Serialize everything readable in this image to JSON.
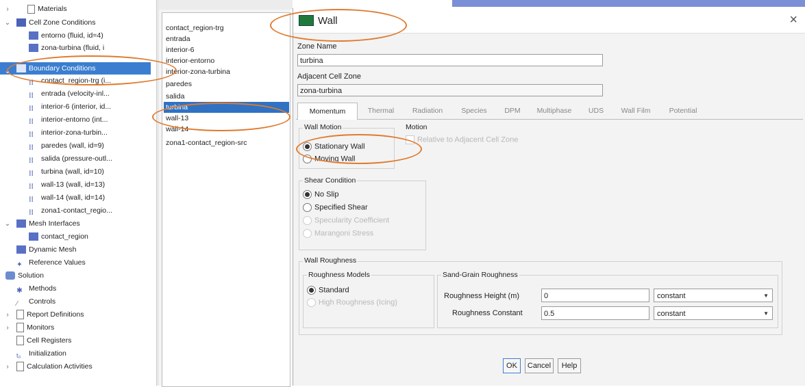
{
  "tree": {
    "materials": "Materials",
    "cell_zone_conditions": "Cell Zone Conditions",
    "cell_zones": [
      "entorno (fluid, id=4)",
      "zona-turbina (fluid, i"
    ],
    "boundary_conditions": "Boundary Conditions",
    "boundaries": [
      "contact_region-trg (i...",
      "entrada (velocity-inl...",
      "interior-6 (interior, id...",
      "interior-entorno (int...",
      "interior-zona-turbin...",
      "paredes (wall, id=9)",
      "salida (pressure-outl...",
      "turbina (wall, id=10)",
      "wall-13 (wall, id=13)",
      "wall-14 (wall, id=14)",
      "zona1-contact_regio..."
    ],
    "mesh_interfaces": "Mesh Interfaces",
    "contact_region": "contact_region",
    "dynamic_mesh": "Dynamic Mesh",
    "reference_values": "Reference Values",
    "solution": "Solution",
    "methods": "Methods",
    "controls": "Controls",
    "report_definitions": "Report Definitions",
    "monitors": "Monitors",
    "cell_registers": "Cell Registers",
    "initialization": "Initialization",
    "calculation_activities": "Calculation Activities"
  },
  "zone_list": {
    "items": [
      "contact_region-trg",
      "entrada",
      "interior-6",
      "interior-entorno",
      "interior-zona-turbina",
      "paredes",
      "salida",
      "turbina",
      "wall-13",
      "wall-14",
      "zona1-contact_region-src"
    ],
    "selected": "turbina"
  },
  "dialog": {
    "title": "Wall",
    "close": "×",
    "zone_name_label": "Zone Name",
    "zone_name_value": "turbina",
    "adjacent_label": "Adjacent Cell Zone",
    "adjacent_value": "zona-turbina",
    "tabs": [
      "Momentum",
      "Thermal",
      "Radiation",
      "Species",
      "DPM",
      "Multiphase",
      "UDS",
      "Wall Film",
      "Potential"
    ],
    "active_tab": "Momentum",
    "wall_motion": {
      "title": "Wall Motion",
      "options": [
        "Stationary Wall",
        "Moving Wall"
      ],
      "selected": "Stationary Wall"
    },
    "motion": {
      "title": "Motion",
      "relative_label": "Relative to Adjacent Cell Zone"
    },
    "shear_condition": {
      "title": "Shear Condition",
      "options": [
        "No Slip",
        "Specified Shear",
        "Specularity Coefficient",
        "Marangoni Stress"
      ],
      "selected": "No Slip"
    },
    "wall_roughness": {
      "title": "Wall Roughness",
      "models_title": "Roughness Models",
      "models": [
        "Standard",
        "High Roughness (Icing)"
      ],
      "selected": "Standard",
      "sand_grain_title": "Sand-Grain Roughness",
      "height_label": "Roughness Height (m)",
      "height_value": "0",
      "height_method": "constant",
      "constant_label": "Roughness Constant",
      "constant_value": "0.5",
      "constant_method": "constant"
    },
    "buttons": {
      "ok": "OK",
      "cancel": "Cancel",
      "help": "Help"
    }
  },
  "colors": {
    "selection": "#3b7ed0",
    "annotation": "#e07a2e"
  }
}
